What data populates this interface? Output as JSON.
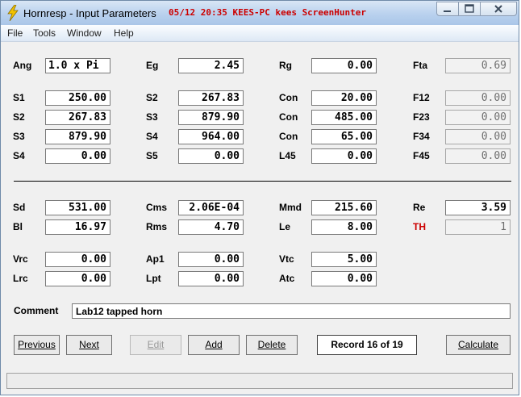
{
  "window": {
    "title": "Hornresp - Input Parameters",
    "capture_stamp": "05/12 20:35 KEES-PC kees ScreenHunter"
  },
  "icons": {
    "app": "lightning-bolt-icon",
    "minimize": "minimize-icon",
    "maximize": "maximize-icon",
    "close": "close-icon"
  },
  "menu": {
    "file": "File",
    "tools": "Tools",
    "window": "Window",
    "help": "Help"
  },
  "params": {
    "ang": {
      "label": "Ang",
      "value": "1.0 x Pi"
    },
    "eg": {
      "label": "Eg",
      "value": "2.45"
    },
    "rg": {
      "label": "Rg",
      "value": "0.00"
    },
    "fta": {
      "label": "Fta",
      "value": "0.69"
    },
    "s1": {
      "label": "S1",
      "value": "250.00"
    },
    "s2a": {
      "label": "S2",
      "value": "267.83"
    },
    "con1": {
      "label": "Con",
      "value": "20.00"
    },
    "f12": {
      "label": "F12",
      "value": "0.00"
    },
    "s2b": {
      "label": "S2",
      "value": "267.83"
    },
    "s3a": {
      "label": "S3",
      "value": "879.90"
    },
    "con2": {
      "label": "Con",
      "value": "485.00"
    },
    "f23": {
      "label": "F23",
      "value": "0.00"
    },
    "s3b": {
      "label": "S3",
      "value": "879.90"
    },
    "s4a": {
      "label": "S4",
      "value": "964.00"
    },
    "con3": {
      "label": "Con",
      "value": "65.00"
    },
    "f34": {
      "label": "F34",
      "value": "0.00"
    },
    "s4b": {
      "label": "S4",
      "value": "0.00"
    },
    "s5": {
      "label": "S5",
      "value": "0.00"
    },
    "l45": {
      "label": "L45",
      "value": "0.00"
    },
    "f45": {
      "label": "F45",
      "value": "0.00"
    },
    "sd": {
      "label": "Sd",
      "value": "531.00"
    },
    "cms": {
      "label": "Cms",
      "value": "2.06E-04"
    },
    "mmd": {
      "label": "Mmd",
      "value": "215.60"
    },
    "re": {
      "label": "Re",
      "value": "3.59"
    },
    "bl": {
      "label": "Bl",
      "value": "16.97"
    },
    "rms": {
      "label": "Rms",
      "value": "4.70"
    },
    "le": {
      "label": "Le",
      "value": "8.00"
    },
    "th": {
      "label": "TH",
      "value": "1"
    },
    "vrc": {
      "label": "Vrc",
      "value": "0.00"
    },
    "ap1": {
      "label": "Ap1",
      "value": "0.00"
    },
    "vtc": {
      "label": "Vtc",
      "value": "5.00"
    },
    "lrc": {
      "label": "Lrc",
      "value": "0.00"
    },
    "lpt": {
      "label": "Lpt",
      "value": "0.00"
    },
    "atc": {
      "label": "Atc",
      "value": "0.00"
    }
  },
  "comment": {
    "label": "Comment",
    "value": "Lab12 tapped horn"
  },
  "buttons": {
    "previous": "Previous",
    "next": "Next",
    "edit": "Edit",
    "add": "Add",
    "delete": "Delete",
    "calculate": "Calculate"
  },
  "record": {
    "text": "Record 16 of 19"
  },
  "colors": {
    "accent_red": "#cc0000",
    "title_gradient_top": "#d9e6f5",
    "title_gradient_bottom": "#aac6e8"
  }
}
